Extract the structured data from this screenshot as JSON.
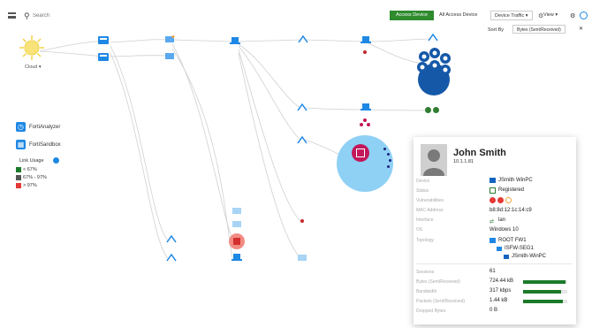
{
  "toolbar": {
    "search_placeholder": "Search",
    "access_device": "Access Device",
    "all_access_device": "All Access Device",
    "device_traffic": "Device Traffic ▾",
    "view": "View ▾",
    "sort_by_label": "Sort By",
    "sort_by_value": "Bytes (Sent/Received)"
  },
  "topology": {
    "cloud_label": "Cloud ▾"
  },
  "legend": {
    "forti_analyzer": "FortiAnalyzer",
    "forti_sandbox": "FortiSandbox",
    "link_usage_label": "Link Usage",
    "ranges": [
      {
        "label": "< 67%",
        "color": "#1b7a2a"
      },
      {
        "label": "67% - 97%",
        "color": "#555555"
      },
      {
        "label": "> 97%",
        "color": "#e53935"
      }
    ]
  },
  "card": {
    "name": "John Smith",
    "ip": "10.1.1.81",
    "rows": [
      {
        "key": "Device",
        "value": "JSmith WinPC"
      },
      {
        "key": "Status",
        "value": "Registered"
      },
      {
        "key": "Vulnerabilities",
        "value": ""
      },
      {
        "key": "MAC Address",
        "value": "b8:8d:12:1c:14:c9"
      },
      {
        "key": "Interface",
        "value": "lan"
      },
      {
        "key": "OS",
        "value": "Windows 10"
      },
      {
        "key": "Topology",
        "value": ""
      }
    ],
    "topology_tree": [
      "ROOT FW1",
      "ISFW-SEG1",
      "JSmith-WinPC"
    ],
    "stats": [
      {
        "key": "Sessions",
        "value": "61",
        "fraction": 0
      },
      {
        "key": "Bytes (Sent/Received)",
        "value": "724.44 kB",
        "fraction": 0.95
      },
      {
        "key": "Bandwidth",
        "value": "317 kbps",
        "fraction": 0.85
      },
      {
        "key": "Packets (Sent/Received)",
        "value": "1.44 kB",
        "fraction": 0.9
      },
      {
        "key": "Dropped Bytes",
        "value": "0 B",
        "fraction": 0
      }
    ]
  },
  "colors": {
    "accent": "#1e88e5",
    "green": "#2e8b2e",
    "red": "#e53935"
  }
}
